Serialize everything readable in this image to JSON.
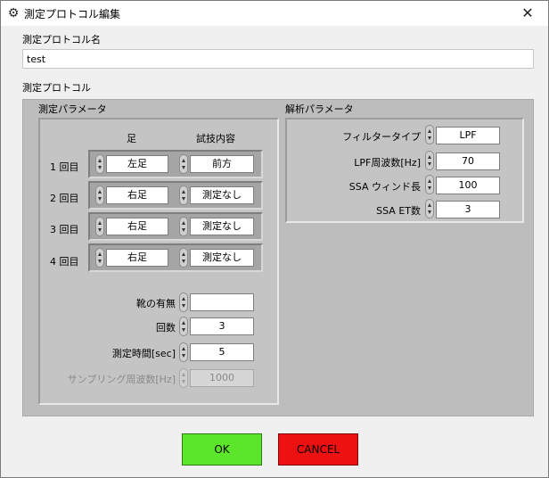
{
  "window": {
    "title": "測定プロトコル編集",
    "close_glyph": "✕",
    "icon_glyph": "⚙"
  },
  "name_section": {
    "label": "測定プロトコル名",
    "value": "test"
  },
  "protocol_section": {
    "label": "測定プロトコル"
  },
  "measure_params": {
    "title": "測定パラメータ",
    "col_foot": "足",
    "col_content": "試技内容",
    "attempts": [
      {
        "label": "1 回目",
        "foot": "左足",
        "content": "前方"
      },
      {
        "label": "2 回目",
        "foot": "右足",
        "content": "測定なし"
      },
      {
        "label": "3 回目",
        "foot": "右足",
        "content": "測定なし"
      },
      {
        "label": "4 回目",
        "foot": "右足",
        "content": "測定なし"
      }
    ],
    "shoes_label": "靴の有無",
    "shoes_value": "",
    "count_label": "回数",
    "count_value": "3",
    "time_label": "測定時間[sec]",
    "time_value": "5",
    "sampling_label": "サンプリング周波数[Hz]",
    "sampling_value": "1000"
  },
  "analysis_params": {
    "title": "解析パラメータ",
    "filter_type_label": "フィルタータイプ",
    "filter_type_value": "LPF",
    "lpf_freq_label": "LPF周波数[Hz]",
    "lpf_freq_value": "70",
    "ssa_window_label": "SSA ウィンド長",
    "ssa_window_value": "100",
    "ssa_et_label": "SSA ET数",
    "ssa_et_value": "3"
  },
  "buttons": {
    "ok_label": "OK",
    "cancel_label": "CANCEL"
  },
  "colors": {
    "ok": "#5ce62b",
    "cancel": "#ee1111",
    "panel": "#bdbdbd"
  }
}
